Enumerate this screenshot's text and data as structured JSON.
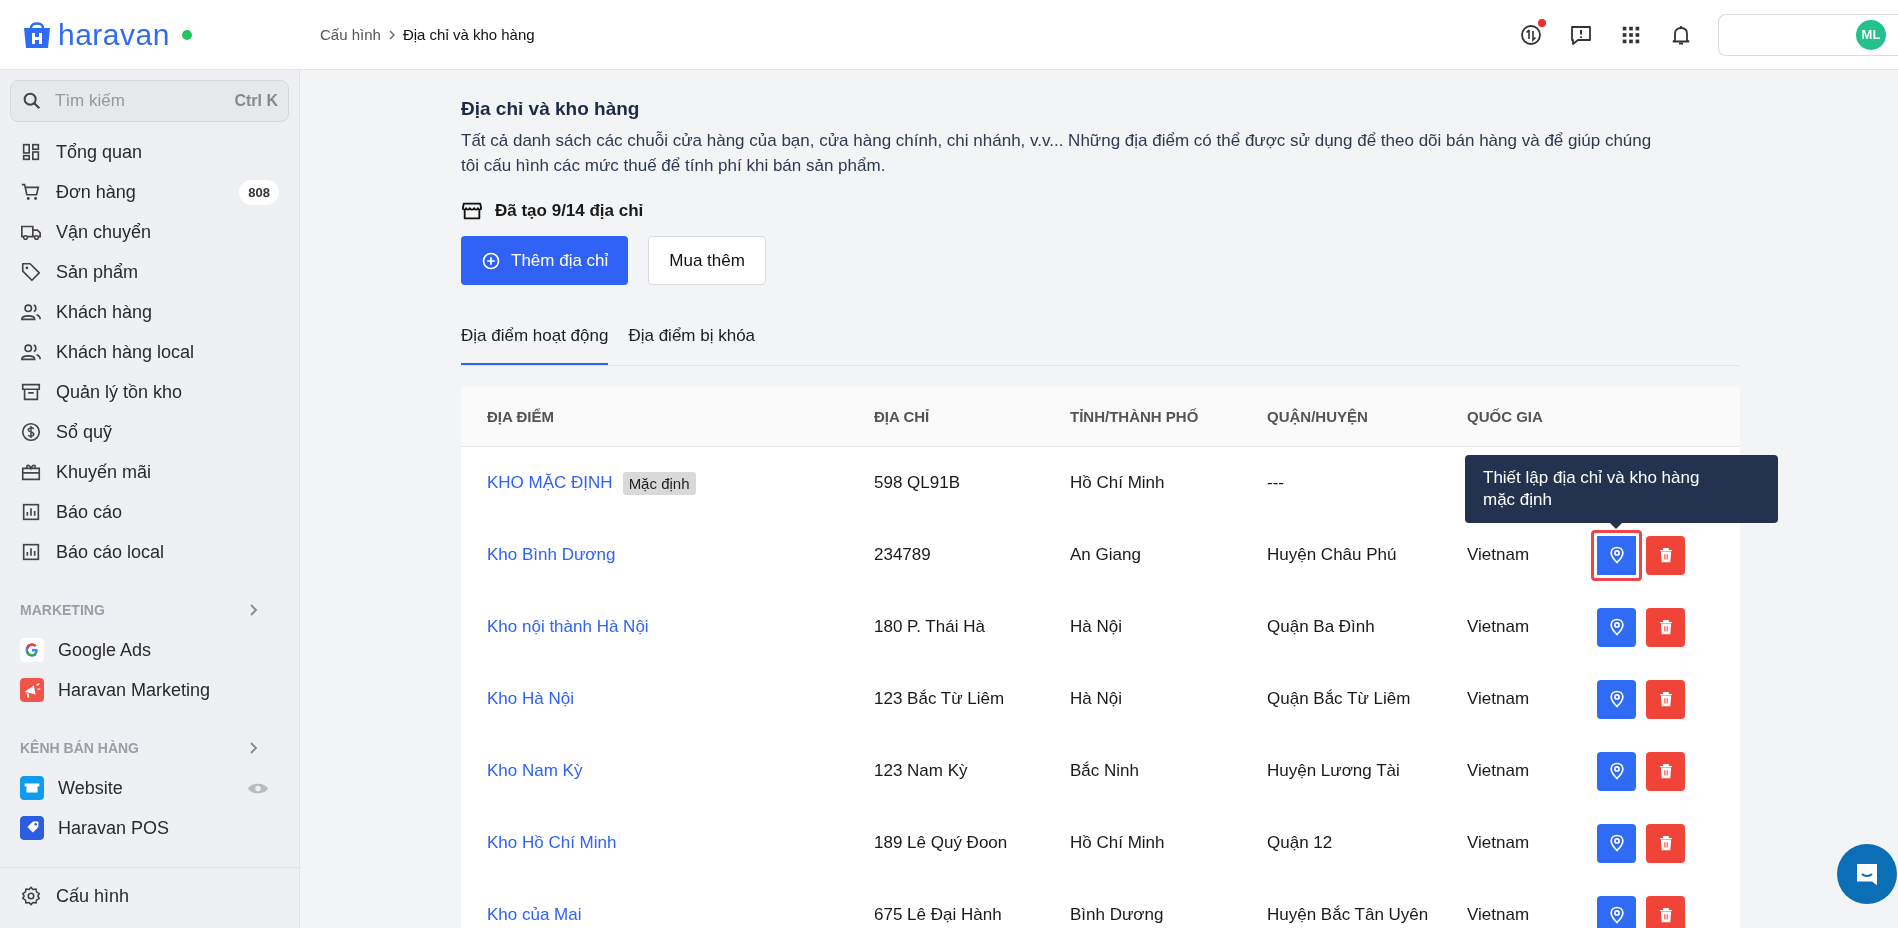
{
  "topbar": {
    "brand": "haravan",
    "breadcrumb": [
      "Cấu hình",
      "Địa chỉ và kho hàng"
    ],
    "avatar": "ML",
    "notification_dot": true
  },
  "sidebar": {
    "search": {
      "placeholder": "Tìm kiếm",
      "shortcut": "Ctrl K"
    },
    "items": [
      {
        "label": "Tổng quan"
      },
      {
        "label": "Đơn hàng",
        "badge": "808"
      },
      {
        "label": "Vận chuyển"
      },
      {
        "label": "Sản phẩm"
      },
      {
        "label": "Khách hàng"
      },
      {
        "label": "Khách hàng local"
      },
      {
        "label": "Quản lý tồn kho"
      },
      {
        "label": "Sổ quỹ"
      },
      {
        "label": "Khuyến mãi"
      },
      {
        "label": "Báo cáo"
      },
      {
        "label": "Báo cáo local"
      }
    ],
    "sections": [
      {
        "title": "MARKETING",
        "items": [
          {
            "label": "Google Ads"
          },
          {
            "label": "Haravan Marketing"
          }
        ]
      },
      {
        "title": "KÊNH BÁN HÀNG",
        "items": [
          {
            "label": "Website"
          },
          {
            "label": "Haravan POS"
          }
        ]
      }
    ],
    "footer": {
      "label": "Cấu hình"
    }
  },
  "page": {
    "title": "Địa chỉ và kho hàng",
    "description": "Tất cả danh sách các chuỗi cửa hàng của bạn, cửa hàng chính, chi nhánh, v.v... Những địa điểm có thể được sử dụng để theo dõi bán hàng và để giúp chúng tôi cấu hình các mức thuế để tính phí khi bán sản phẩm.",
    "quota": "Đã tạo 9/14 địa chỉ",
    "buttons": [
      {
        "label": "Thêm địa chỉ",
        "kind": "primary"
      },
      {
        "label": "Mua thêm",
        "kind": "secondary"
      }
    ]
  },
  "tabs": [
    {
      "label": "Địa điểm hoạt động",
      "selected": true
    },
    {
      "label": "Địa điểm bị khóa",
      "selected": false
    }
  ],
  "table": {
    "columns": [
      "ĐỊA ĐIỂM",
      "ĐỊA CHỈ",
      "TỈNH/THÀNH PHỐ",
      "QUẬN/HUYỆN",
      "QUỐC GIA"
    ],
    "tooltip": "Thiết lập địa chỉ và kho hàng mặc định",
    "rows": [
      {
        "name": "KHO MẶC ĐỊNH",
        "badge": "Mặc định",
        "address": "598 QL91B",
        "province": "Hồ Chí Minh",
        "district": "---",
        "actions": false
      },
      {
        "name": "Kho Bình Dương",
        "address": "234789",
        "province": "An Giang",
        "district": "Huyện Châu Phú",
        "country": "Vietnam",
        "actions": true,
        "focused": true
      },
      {
        "name": "Kho nội thành Hà Nội",
        "address": "180 P. Thái Hà",
        "province": "Hà Nội",
        "district": "Quận Ba Đình",
        "country": "Vietnam",
        "actions": true,
        "focused": false
      },
      {
        "name": "Kho Hà Nội",
        "address": "123 Bắc Từ Liêm",
        "province": "Hà Nội",
        "district": "Quận Bắc Từ Liêm",
        "country": "Vietnam",
        "actions": true,
        "focused": false
      },
      {
        "name": "Kho Nam Kỳ",
        "address": "123 Nam Kỳ",
        "province": "Bắc Ninh",
        "district": "Huyện Lương Tài",
        "country": "Vietnam",
        "actions": true,
        "focused": false
      },
      {
        "name": "Kho Hồ Chí Minh",
        "address": "189 Lê Quý Đoon",
        "province": "Hồ Chí Minh",
        "district": "Quận 12",
        "country": "Vietnam",
        "actions": true,
        "focused": false
      },
      {
        "name": "Kho của Mai",
        "address": "675 Lê Đại Hành",
        "province": "Bình Dương",
        "district": "Huyện Bắc Tân Uyên",
        "country": "Vietnam",
        "actions": true,
        "focused": false
      }
    ]
  }
}
